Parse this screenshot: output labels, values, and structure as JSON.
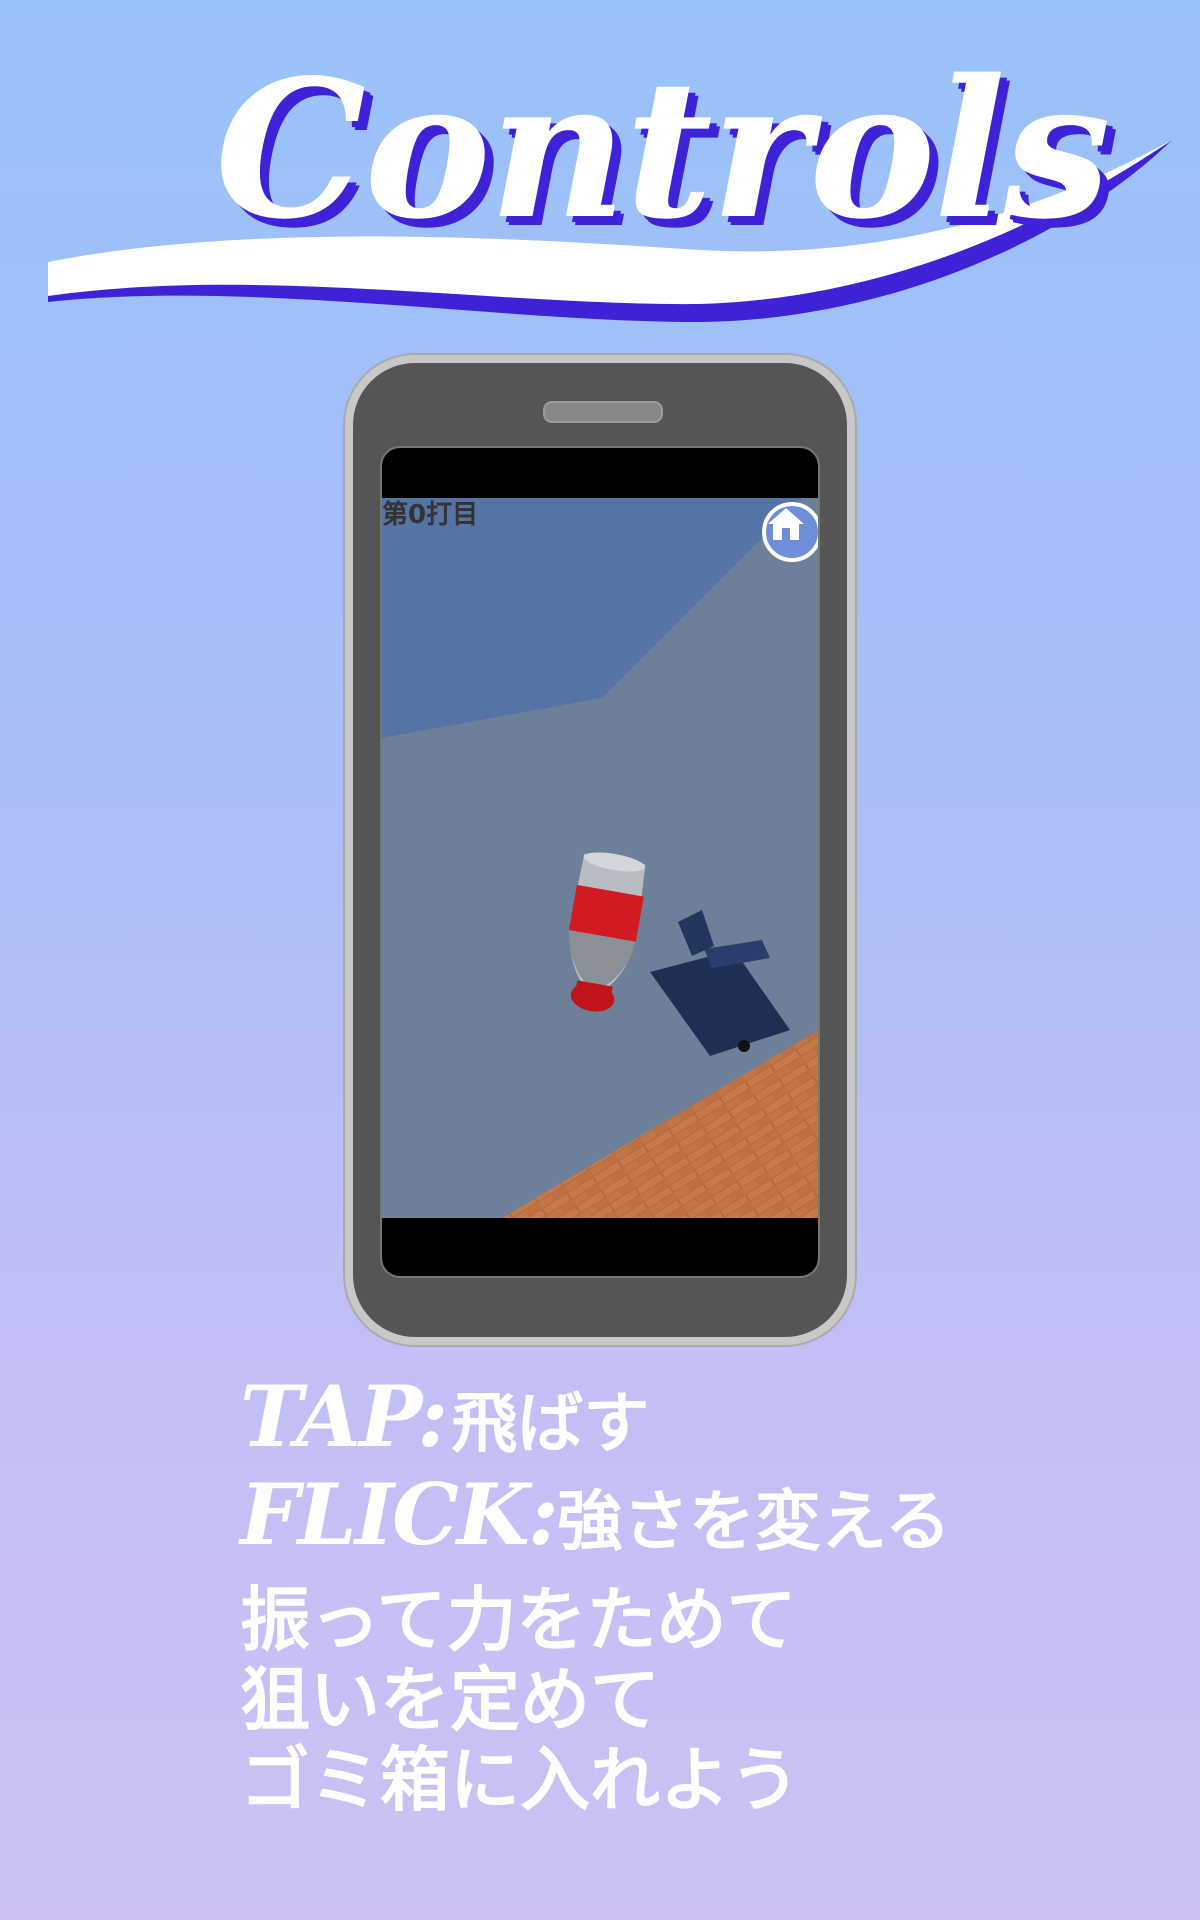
{
  "title": "Controls",
  "colors": {
    "bg_top": "#99c2f9",
    "bg_bottom": "#cdc1f4",
    "title_shadow": "#3d22d8",
    "title_fill": "#ffffff"
  },
  "game_screen": {
    "shot_counter": "第0打目",
    "home_icon": "home-icon"
  },
  "instructions": {
    "tap_key": "TAP:",
    "tap_action": "飛ばす",
    "flick_key": "FLICK:",
    "flick_action": "強さを変える",
    "line1": "振って力をためて",
    "line2": "狙いを定めて",
    "line3": "ゴミ箱に入れよう"
  }
}
